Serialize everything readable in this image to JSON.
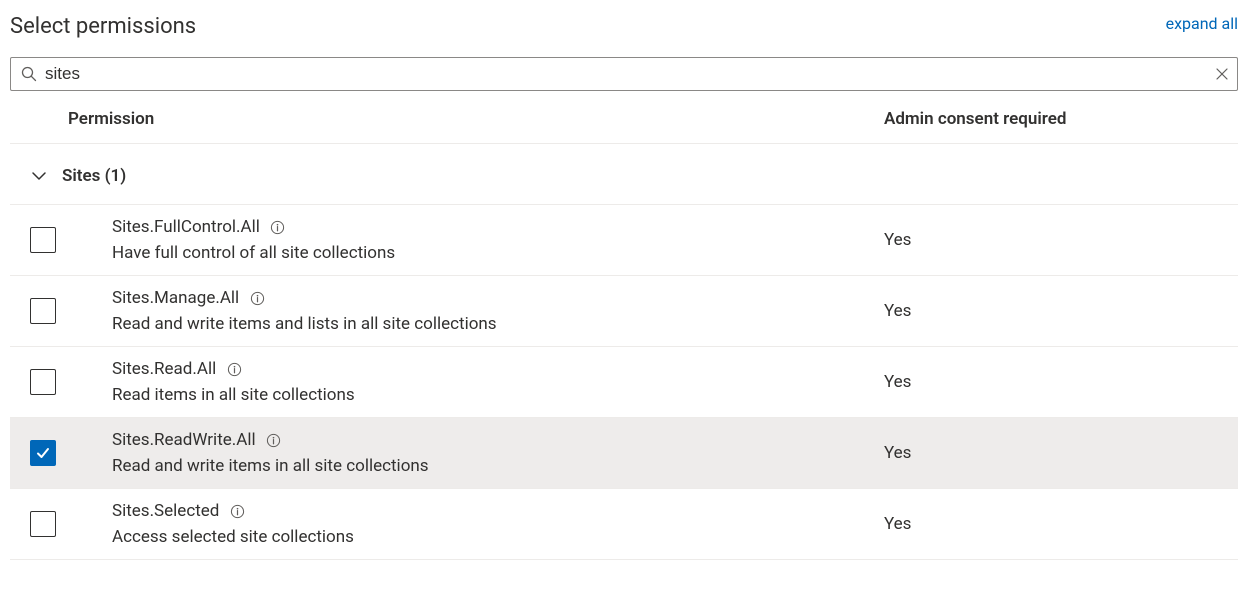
{
  "header": {
    "title": "Select permissions",
    "expand_link": "expand all"
  },
  "search": {
    "value": "sites"
  },
  "columns": {
    "permission": "Permission",
    "admin_consent": "Admin consent required"
  },
  "group": {
    "label": "Sites (1)"
  },
  "permissions": [
    {
      "name": "Sites.FullControl.All",
      "description": "Have full control of all site collections",
      "admin_consent": "Yes",
      "checked": false
    },
    {
      "name": "Sites.Manage.All",
      "description": "Read and write items and lists in all site collections",
      "admin_consent": "Yes",
      "checked": false
    },
    {
      "name": "Sites.Read.All",
      "description": "Read items in all site collections",
      "admin_consent": "Yes",
      "checked": false
    },
    {
      "name": "Sites.ReadWrite.All",
      "description": "Read and write items in all site collections",
      "admin_consent": "Yes",
      "checked": true
    },
    {
      "name": "Sites.Selected",
      "description": "Access selected site collections",
      "admin_consent": "Yes",
      "checked": false
    }
  ]
}
